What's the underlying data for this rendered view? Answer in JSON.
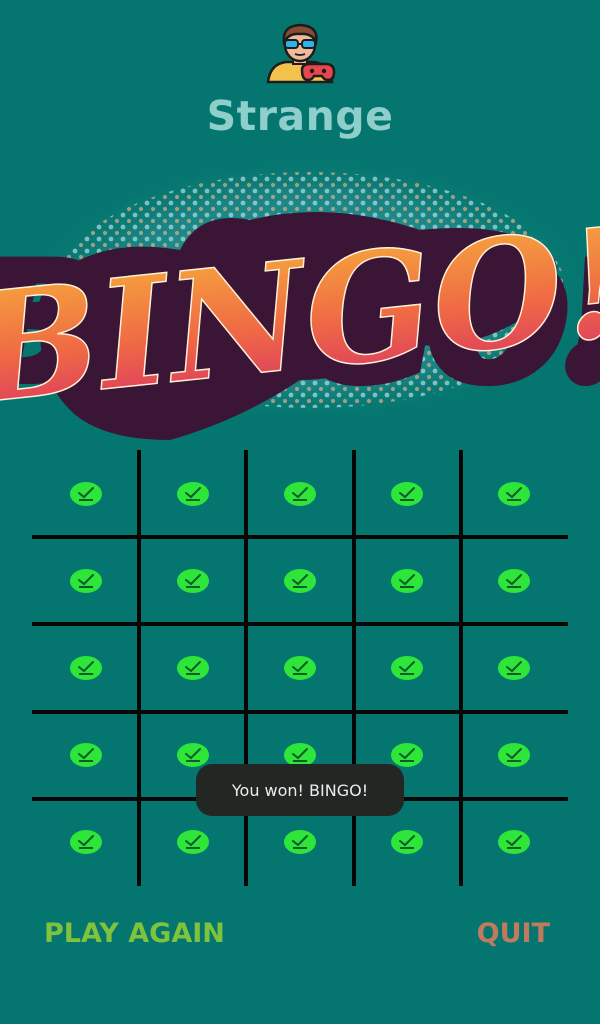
{
  "player": {
    "name": "Strange",
    "avatar_icon": "gamer-avatar-icon"
  },
  "logo": {
    "text": "BINGO!"
  },
  "board": {
    "rows": 5,
    "cols": 5,
    "cells": [
      [
        "checked",
        "checked",
        "checked",
        "checked",
        "checked"
      ],
      [
        "checked",
        "checked",
        "checked",
        "checked",
        "checked"
      ],
      [
        "checked",
        "checked",
        "checked",
        "checked",
        "checked"
      ],
      [
        "checked",
        "checked",
        "checked",
        "checked",
        "checked"
      ],
      [
        "checked",
        "checked",
        "checked",
        "checked",
        "checked"
      ]
    ],
    "cell_icon": "checkmark-circle-icon",
    "icon_color": "#2ee63a"
  },
  "toast": {
    "message": "You won! BINGO!"
  },
  "actions": {
    "play_again": "PLAY AGAIN",
    "quit": "QUIT"
  },
  "colors": {
    "background": "#05766f",
    "play_again": "#7fc23c",
    "quit": "#c07a5e",
    "grid_lines": "#050505"
  }
}
